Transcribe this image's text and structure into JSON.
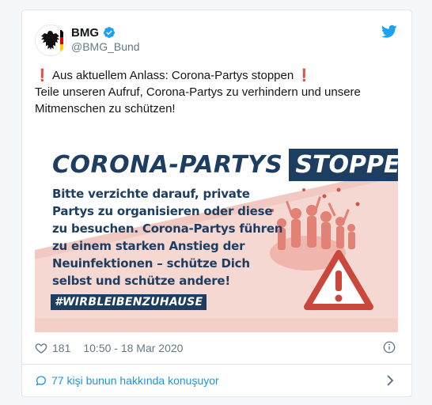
{
  "colors": {
    "twitter_blue": "#1da1f2",
    "link_blue": "#1b95e0",
    "muted_gray": "#657786",
    "poster_navy": "#1d3e60",
    "poster_red": "#c9473b",
    "poster_pink": "#f6d8d3"
  },
  "author": {
    "display_name": "BMG",
    "handle": "@BMG_Bund",
    "verified": true,
    "avatar_icon": "german-eagle-icon"
  },
  "tweet": {
    "line1_prefix": "❗",
    "line1_text": " Aus aktuellem Anlass: Corona-Partys stoppen  ",
    "line1_suffix": "❗",
    "line2": "Teile unseren Aufruf, Corona-Partys zu verhindern und unsere",
    "line3": "Mitmenschen zu schützen!"
  },
  "media": {
    "headline_part1": "CORONA-PARTYS",
    "headline_part2": "STOPPEN!",
    "body_lines": [
      "Bitte verzichte darauf, private",
      "Partys zu organisieren oder diese",
      "zu besuchen. Corona-Partys führen",
      "zu einem starken Anstieg der",
      "Neuinfektionen – schütze Dich",
      "selbst und schütze andere!"
    ],
    "hashtag": "#WIRBLEIBENZUHAUSE",
    "illustration_icons": [
      "party-crowd-icon",
      "warning-triangle-icon"
    ]
  },
  "meta": {
    "likes": "181",
    "timestamp": "10:50 - 18 Mar 2020"
  },
  "footer": {
    "conversation_text": "77 kişi bunun hakkında konuşuyor"
  }
}
